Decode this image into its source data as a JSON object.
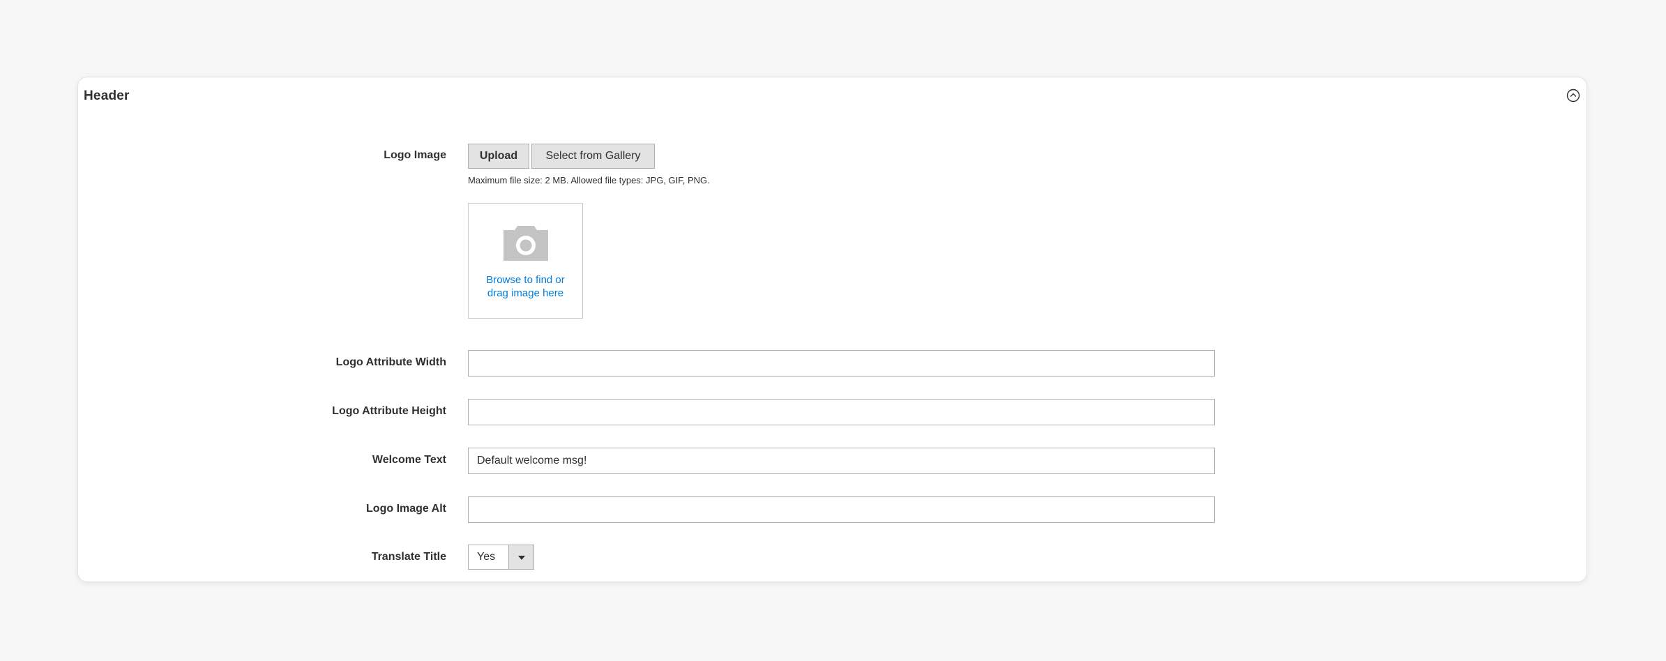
{
  "panel": {
    "title": "Header"
  },
  "logo_image": {
    "label": "Logo Image",
    "upload_label": "Upload",
    "gallery_label": "Select from Gallery",
    "note": "Maximum file size: 2 MB. Allowed file types: JPG, GIF, PNG.",
    "dropzone_line1": "Browse to find or",
    "dropzone_line2": "drag image here"
  },
  "fields": {
    "logo_width": {
      "label": "Logo Attribute Width",
      "value": ""
    },
    "logo_height": {
      "label": "Logo Attribute Height",
      "value": ""
    },
    "welcome_text": {
      "label": "Welcome Text",
      "value": "Default welcome msg!"
    },
    "logo_alt": {
      "label": "Logo Image Alt",
      "value": ""
    },
    "translate_title": {
      "label": "Translate Title",
      "value": "Yes"
    }
  },
  "colors": {
    "link": "#007bdb",
    "button_bg": "#e3e3e3",
    "border": "#adadad",
    "text": "#303030"
  }
}
